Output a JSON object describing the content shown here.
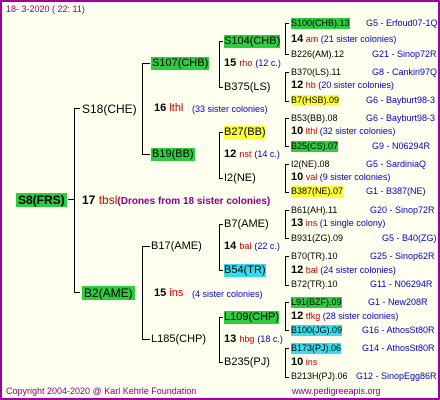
{
  "header": "18-  3-2020  ( 22: 11)",
  "root": {
    "label": "S8(FRS)",
    "num": "17",
    "code": "tbsl",
    "note": "(Drones from 18 sister colonies)"
  },
  "sire": {
    "label": "S18(CHE)",
    "num": "16",
    "code": "lthl",
    "note": "(33 sister colonies)",
    "a": {
      "label": "S107(CHB)",
      "num": "15",
      "code": "rho",
      "note": "(12 c.)",
      "a": {
        "label": "S104(CHB)",
        "num": "14",
        "code": "am",
        "note": "(21 sister colonies)",
        "top": "S100(CHB).13",
        "top_info": "G5 - Erfoud07-1Q",
        "bottom": "B226(AM).12",
        "bottom_info": "G21 - Sinop72R"
      },
      "b": {
        "label": "B375(LS)",
        "num": "12",
        "code": "hb",
        "note": "(20 sister colonies)",
        "top": "B370(LS).11",
        "top_info": "G8 - Cankiri97Q",
        "bottom": "B7(HSB).09",
        "bottom_info": "G6 - Bayburt98-3"
      }
    },
    "b": {
      "label": "B19(BB)",
      "num": "12",
      "code": "nst",
      "note": "(14 c.)",
      "a": {
        "label": "B27(BB)",
        "num": "10",
        "code": "lthl",
        "note": "(32 sister colonies)",
        "top": "B53(BB).08",
        "top_info": "G6 - Bayburt98-3",
        "bottom": "B25(CS).07",
        "bottom_info": "G9 - N06294R"
      },
      "b": {
        "label": "I2(NE)",
        "num": "10",
        "code": "val",
        "note": "(9 sister colonies)",
        "top": "I2(NE).08",
        "top_info": "G5 - SardiniaQ",
        "bottom": "B387(NE).07",
        "bottom_info": "G1 - B387(NE)"
      }
    }
  },
  "dam": {
    "label": "B2(AME)",
    "num": "15",
    "code": "ins",
    "note": "(4 sister colonies)",
    "a": {
      "label": "B17(AME)",
      "num": "14",
      "code": "bal",
      "note": "(22 c.)",
      "a": {
        "label": "B7(AME)",
        "num": "13",
        "code": "ins",
        "note": "(1 single colony)",
        "top": "B61(AH).11",
        "top_info": "G20 - Sinop72R",
        "bottom": "B931(ZG).09",
        "bottom_info": "G5 - B40(ZG)"
      },
      "b": {
        "label": "B54(TR)",
        "num": "12",
        "code": "bal",
        "note": "(24 sister colonies)",
        "top": "B70(TR).10",
        "top_info": "G25 - Sinop62R",
        "bottom": "B72(TR).10",
        "bottom_info": "G11 - N06294R"
      }
    },
    "b": {
      "label": "L185(CHP)",
      "num": "13",
      "code": "hbg",
      "note": "(18 c.)",
      "a": {
        "label": "L109(CHP)",
        "num": "12",
        "code": "tfkg",
        "note": "(28 sister colonies)",
        "top": "L91(BZF).09",
        "top_info": "G1 - New208R",
        "bottom": "B100(JG).09",
        "bottom_info": "G16 - AthosSt80R"
      },
      "b": {
        "label": "B235(PJ)",
        "num": "10",
        "code": "ins",
        "note": "",
        "top": "B173(PJ).06",
        "top_info": "G14 - AthosSt80R",
        "bottom": "B213H(PJ).06",
        "bottom_info": "G12 - SinopEgg86R"
      }
    }
  },
  "footer": {
    "copyright": "Copyright 2004-2020 @ Karl Kehrle Foundation",
    "url": "www.pedigreeapis.org"
  },
  "colors": {
    "green": "#2ecc40",
    "yellow": "#ffff33",
    "cyan": "#33ddee",
    "red": "#cc0000",
    "blue": "#0000cc",
    "purple": "#8b008b",
    "border": "#a000a0"
  }
}
